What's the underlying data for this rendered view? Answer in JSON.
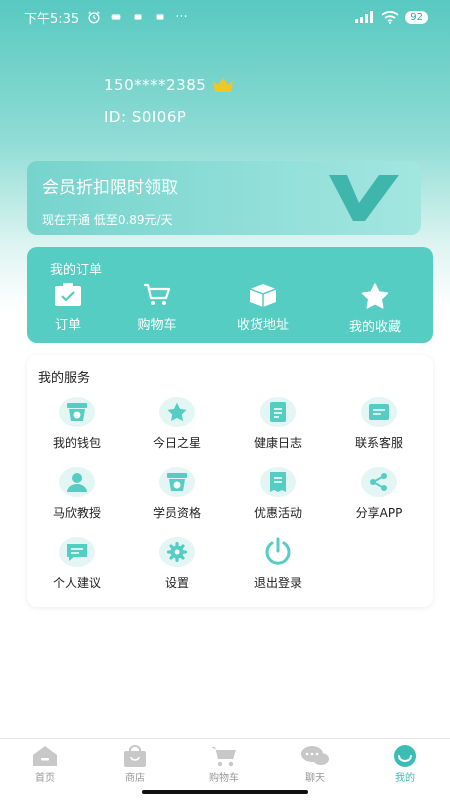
{
  "status_bar": {
    "time": "下午5:35",
    "dots": "···",
    "battery": "92"
  },
  "profile": {
    "phone": "150****2385",
    "uid": "ID: S0I06P"
  },
  "vip_banner": {
    "title": "会员折扣限时领取",
    "subtitle": "现在开通 低至0.89元/天"
  },
  "orders": {
    "heading": "我的订单",
    "items": [
      {
        "label": "订单",
        "icon": "order-clipboard-icon"
      },
      {
        "label": "购物车",
        "icon": "cart-icon"
      },
      {
        "label": "收货地址",
        "icon": "package-box-icon"
      },
      {
        "label": "我的收藏",
        "icon": "star-icon"
      }
    ]
  },
  "services": {
    "heading": "我的服务",
    "items": [
      {
        "label": "我的钱包",
        "icon": "wallet-badge-icon"
      },
      {
        "label": "今日之星",
        "icon": "star-icon"
      },
      {
        "label": "健康日志",
        "icon": "document-icon"
      },
      {
        "label": "联系客服",
        "icon": "message-icon"
      },
      {
        "label": "马欣教授",
        "icon": "person-icon"
      },
      {
        "label": "学员资格",
        "icon": "badge-icon"
      },
      {
        "label": "优惠活动",
        "icon": "coupon-list-icon"
      },
      {
        "label": "分享APP",
        "icon": "share-icon"
      },
      {
        "label": "个人建议",
        "icon": "chat-icon"
      },
      {
        "label": "设置",
        "icon": "gear-icon"
      },
      {
        "label": "退出登录",
        "icon": "power-icon"
      }
    ]
  },
  "tabbar": {
    "items": [
      {
        "label": "首页",
        "icon": "home-icon"
      },
      {
        "label": "商店",
        "icon": "shop-bag-icon"
      },
      {
        "label": "购物车",
        "icon": "cart-icon"
      },
      {
        "label": "聊天",
        "icon": "chat-bubbles-icon"
      },
      {
        "label": "我的",
        "icon": "smile-profile-icon",
        "active": true
      }
    ]
  },
  "colors": {
    "accent": "#56cdc3",
    "crown": "#f3c623",
    "inactive_tab": "#c8c8c8"
  }
}
